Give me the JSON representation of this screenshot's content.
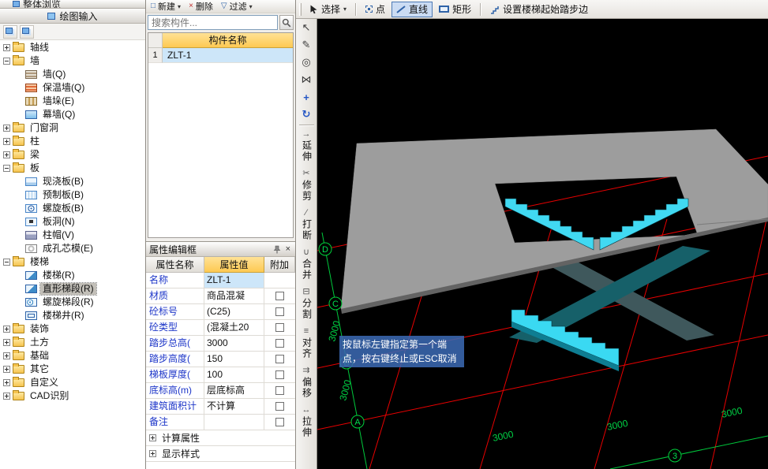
{
  "nav_panel": {
    "top_partial_label": "整体浏览",
    "tab_label": "绘图输入",
    "tree": [
      {
        "label": "轴线",
        "icon": "folder",
        "level": 0,
        "exp": "+"
      },
      {
        "label": "墙",
        "icon": "folder",
        "level": 0,
        "exp": "-"
      },
      {
        "label": "墙(Q)",
        "icon": "wall",
        "level": 1
      },
      {
        "label": "保温墙(Q)",
        "icon": "insulation-wall",
        "level": 1
      },
      {
        "label": "墙垛(E)",
        "icon": "wall-pier",
        "level": 1
      },
      {
        "label": "幕墙(Q)",
        "icon": "curtain-wall",
        "level": 1
      },
      {
        "label": "门窗洞",
        "icon": "folder",
        "level": 0,
        "exp": "+"
      },
      {
        "label": "柱",
        "icon": "folder",
        "level": 0,
        "exp": "+"
      },
      {
        "label": "梁",
        "icon": "folder",
        "level": 0,
        "exp": "+"
      },
      {
        "label": "板",
        "icon": "folder",
        "level": 0,
        "exp": "-"
      },
      {
        "label": "现浇板(B)",
        "icon": "cast-slab",
        "level": 1
      },
      {
        "label": "预制板(B)",
        "icon": "precast-slab",
        "level": 1
      },
      {
        "label": "螺旋板(B)",
        "icon": "spiral-slab",
        "level": 1
      },
      {
        "label": "板洞(N)",
        "icon": "slab-hole",
        "level": 1
      },
      {
        "label": "柱帽(V)",
        "icon": "column-cap",
        "level": 1
      },
      {
        "label": "成孔芯模(E)",
        "icon": "core-mold",
        "level": 1
      },
      {
        "label": "楼梯",
        "icon": "folder",
        "level": 0,
        "exp": "-"
      },
      {
        "label": "楼梯(R)",
        "icon": "stair",
        "level": 1
      },
      {
        "label": "直形梯段(R)",
        "icon": "straight-stair",
        "level": 1,
        "selected": true
      },
      {
        "label": "螺旋梯段(R)",
        "icon": "spiral-stair",
        "level": 1
      },
      {
        "label": "楼梯井(R)",
        "icon": "stair-well",
        "level": 1
      },
      {
        "label": "装饰",
        "icon": "folder",
        "level": 0,
        "exp": "+"
      },
      {
        "label": "土方",
        "icon": "folder",
        "level": 0,
        "exp": "+"
      },
      {
        "label": "基础",
        "icon": "folder",
        "level": 0,
        "exp": "+"
      },
      {
        "label": "其它",
        "icon": "folder",
        "level": 0,
        "exp": "+"
      },
      {
        "label": "自定义",
        "icon": "folder",
        "level": 0,
        "exp": "+"
      },
      {
        "label": "CAD识别",
        "icon": "folder",
        "level": 0,
        "exp": "+"
      }
    ]
  },
  "component_panel": {
    "toolbar": [
      {
        "name": "new",
        "label": "新建",
        "arrow": true
      },
      {
        "name": "delete",
        "label": "删除",
        "arrow": false
      },
      {
        "name": "filter",
        "label": "过滤",
        "arrow": true
      }
    ],
    "search_placeholder": "搜索构件...",
    "list": {
      "header": "构件名称",
      "rows": [
        {
          "no": "1",
          "name": "ZLT-1"
        }
      ]
    }
  },
  "properties_panel": {
    "title": "属性编辑框",
    "col_name": "属性名称",
    "col_value": "属性值",
    "col_attach": "附加",
    "rows": [
      {
        "name": "名称",
        "value": "ZLT-1",
        "checkbox": false
      },
      {
        "name": "材质",
        "value": "商品混凝",
        "checkbox": true
      },
      {
        "name": "砼标号",
        "value": "(C25)",
        "checkbox": true
      },
      {
        "name": "砼类型",
        "value": "(混凝土20",
        "checkbox": true
      },
      {
        "name": "踏步总高(",
        "value": "3000",
        "checkbox": true
      },
      {
        "name": "踏步高度(",
        "value": "150",
        "checkbox": true
      },
      {
        "name": "梯板厚度(",
        "value": "100",
        "checkbox": true
      },
      {
        "name": "底标高(m)",
        "value": "层底标高",
        "checkbox": true
      },
      {
        "name": "建筑面积计",
        "value": "不计算",
        "checkbox": true
      },
      {
        "name": "备注",
        "value": "",
        "checkbox": true
      }
    ],
    "groups": [
      {
        "label": "计算属性"
      },
      {
        "label": "显示样式"
      }
    ]
  },
  "draw_toolbar": {
    "select_label": "选择",
    "point_label": "点",
    "line_label": "直线",
    "rect_label": "矩形",
    "stair_label": "设置楼梯起始踏步边"
  },
  "edit_toolbar": {
    "icons": [
      {
        "name": "select-cursor"
      },
      {
        "name": "brush"
      },
      {
        "name": "spiral"
      },
      {
        "name": "mirror"
      },
      {
        "name": "move"
      },
      {
        "name": "rotate"
      }
    ],
    "tools": [
      {
        "name": "extend",
        "label": "延伸"
      },
      {
        "name": "trim",
        "label": "修剪"
      },
      {
        "name": "break",
        "label": "打断"
      },
      {
        "name": "merge",
        "label": "合并"
      },
      {
        "name": "divide",
        "label": "分割"
      },
      {
        "name": "align",
        "label": "对齐"
      },
      {
        "name": "offset",
        "label": "偏移"
      },
      {
        "name": "stretch",
        "label": "拉伸"
      }
    ]
  },
  "viewport": {
    "tooltip": "按鼠标左键指定第一个端点，按右键终止或ESC取消",
    "axes": {
      "letters": [
        "D",
        "C",
        "B",
        "A"
      ],
      "number": "3"
    },
    "dims_left": [
      "3000",
      "3000"
    ],
    "dims_bottom": [
      "3000",
      "3000",
      "3000"
    ],
    "colors": {
      "stair": "#41d9f2",
      "slab": "#9d9d9d",
      "grid": "#e80000",
      "axis": "#00c83c"
    }
  }
}
